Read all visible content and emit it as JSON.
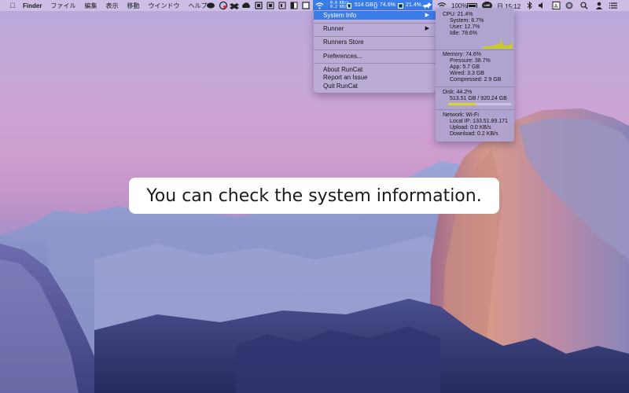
{
  "menubar": {
    "apple_icon": "apple-icon",
    "app_menus": [
      "Finder",
      "ファイル",
      "編集",
      "表示",
      "移動",
      "ウインドウ",
      "ヘルプ"
    ],
    "status_icons": [
      "message-bubble-icon",
      "creative-cloud-icon",
      "dropbox-icon",
      "cloud-upload-icon",
      "box-icon",
      "window-grid-icon",
      "square-icon",
      "half-square-icon",
      "stop-square-icon",
      "wifi-icon"
    ],
    "runcat": {
      "net_up": "0.0 KB/s",
      "net_down": "0.2 KB/s",
      "disk": "514 GB",
      "memory": "74.6%",
      "cpu": "21.4%",
      "cat_icon": "running-cat-icon"
    },
    "wifi_icon": "wifi-icon",
    "battery_percent": "100%",
    "battery_icon": "battery-icon",
    "line_badge": "LINE",
    "clock": "日 15:12",
    "right_icons": [
      "bluetooth-icon",
      "volume-icon",
      "input-source-icon",
      "siri-icon",
      "spotlight-search-icon",
      "user-icon",
      "notification-center-icon"
    ]
  },
  "menu": {
    "items": [
      {
        "label": "System Info",
        "has_submenu": true,
        "active": true
      },
      {
        "label": "Runner",
        "has_submenu": true,
        "active": false
      },
      {
        "label": "Runners Store",
        "has_submenu": false,
        "active": false
      },
      {
        "label": "Preferences...",
        "has_submenu": false,
        "active": false
      },
      {
        "label": "About RunCat",
        "has_submenu": false,
        "active": false
      },
      {
        "label": "Report an Issue",
        "has_submenu": false,
        "active": false
      },
      {
        "label": "Quit RunCat",
        "has_submenu": false,
        "active": false
      }
    ],
    "arrow": "▶"
  },
  "system_info": {
    "cpu": {
      "title": "CPU: 21.4%",
      "system": "System: 8.7%",
      "user": "User: 12.7%",
      "idle": "Idle: 78.6%",
      "history": [
        5,
        4,
        6,
        5,
        7,
        6,
        5,
        8,
        6,
        7,
        9,
        8,
        10,
        12,
        9,
        14,
        11,
        28,
        12,
        8,
        9,
        7,
        10,
        8,
        9,
        11,
        9,
        21
      ]
    },
    "memory": {
      "title": "Memory: 74.6%",
      "pressure": "Pressure: 38.7%",
      "app": "App: 5.7 GB",
      "wired": "Wired: 3.3 GB",
      "compressed": "Compressed: 2.9 GB"
    },
    "disk": {
      "title": "Disk: 44.2%",
      "usage": "513.51 GB / 920.24 GB",
      "used_fraction": 0.442,
      "bar_color": "#d8d628"
    },
    "network": {
      "title": "Network: Wi-Fi",
      "local_ip": "Local IP: 133.51.89.171",
      "upload": "Upload:   0.0 KB/s",
      "download": "Download:   0.2 KB/s"
    }
  },
  "caption": "You can check the system information.",
  "colors": {
    "menu_highlight": "#3a7ce8",
    "disk_bar": "#d8d628",
    "cpu_graph": "#c8cc2a"
  }
}
